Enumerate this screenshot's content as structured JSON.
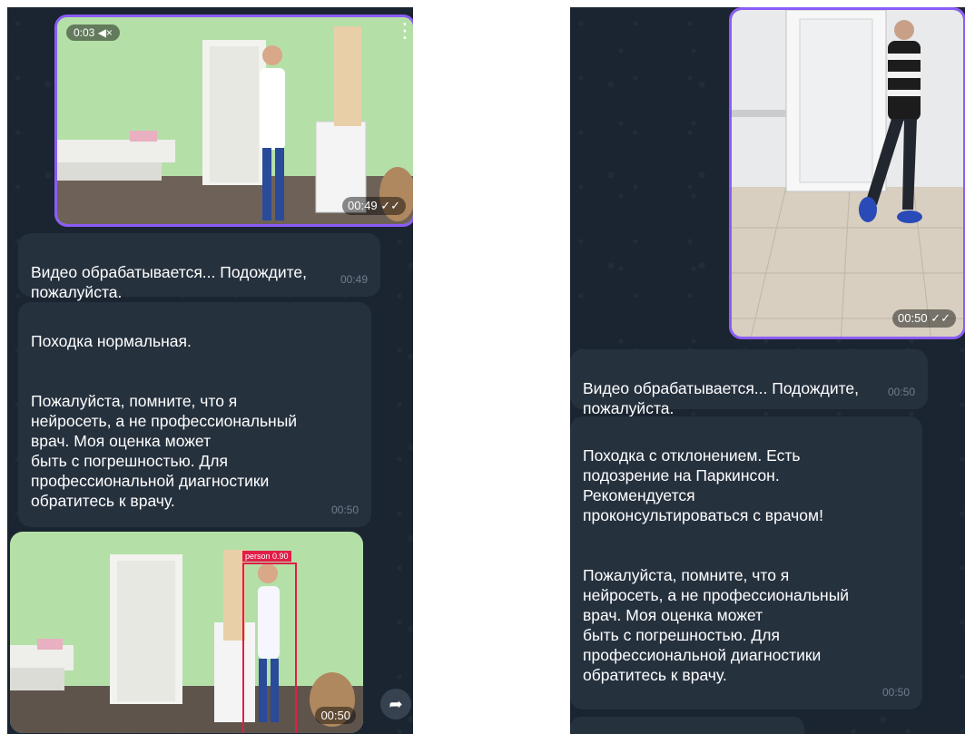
{
  "left": {
    "video1": {
      "duration": "0:03",
      "sound_icon": "mute-icon",
      "time": "00:49",
      "status_icon": "double-check-icon"
    },
    "msg1": {
      "text": "Видео обрабатывается... Подождите,\nпожалуйста.",
      "time": "00:49"
    },
    "msg2": {
      "text": "Походка нормальная.\n\n\nПожалуйста, помните, что я\nнейросеть, а не профессиональный\nврач. Моя оценка может\nбыть с погрешностью. Для\nпрофессиональной диагностики\nобратитесь к врачу.",
      "time": "00:50"
    },
    "video2": {
      "detection_label": "person 0.90",
      "time": "00:50",
      "share_icon": "share-icon"
    }
  },
  "right": {
    "video1": {
      "time": "00:50",
      "status_icon": "double-check-icon"
    },
    "msg1": {
      "text": "Видео обрабатывается... Подождите,\nпожалуйста.",
      "time": "00:50"
    },
    "msg2": {
      "text": "Походка с отклонением. Есть\nподозрение на Паркинсон.\nРекомендуется\nпроконсультироваться с врачом!\n\n\nПожалуйста, помните, что я\nнейросеть, а не профессиональный\nврач. Моя оценка может\nбыть с погрешностью. Для\nпрофессиональной диагностики\nобратитесь к врачу.",
      "time": "00:50"
    }
  },
  "colors": {
    "chat_bg": "#1b2531",
    "bubble_bg": "#26313e",
    "sent_border": "#8b5cf6",
    "detection_box": "#e11d48"
  }
}
